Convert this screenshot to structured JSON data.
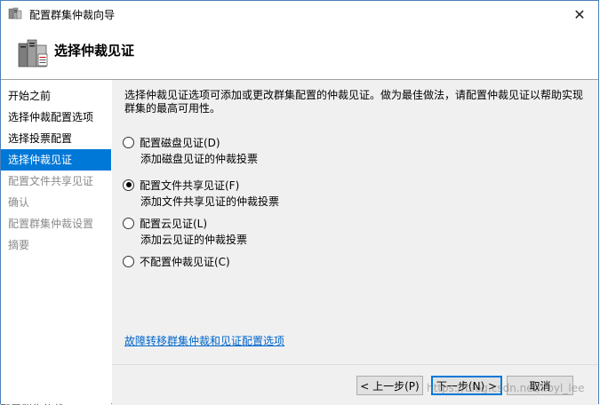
{
  "window": {
    "title": "配置群集仲裁向导",
    "close_glyph": "✕"
  },
  "header": {
    "page_title": "选择仲裁见证"
  },
  "sidebar": {
    "items": [
      {
        "label": "开始之前",
        "state": "normal"
      },
      {
        "label": "选择仲裁配置选项",
        "state": "normal"
      },
      {
        "label": "选择投票配置",
        "state": "normal"
      },
      {
        "label": "选择仲裁见证",
        "state": "selected"
      },
      {
        "label": "配置文件共享见证",
        "state": "disabled"
      },
      {
        "label": "确认",
        "state": "disabled"
      },
      {
        "label": "配置群集仲裁设置",
        "state": "disabled"
      },
      {
        "label": "摘要",
        "state": "disabled"
      }
    ]
  },
  "main": {
    "description": "选择仲裁见证选项可添加或更改群集配置的仲裁见证。做为最佳做法，请配置仲裁见证以帮助实现群集的最高可用性。",
    "options": [
      {
        "label": "配置磁盘见证(D)",
        "sub": "添加磁盘见证的仲裁投票",
        "checked": false
      },
      {
        "label": "配置文件共享见证(F)",
        "sub": "添加文件共享见证的仲裁投票",
        "checked": true
      },
      {
        "label": "配置云见证(L)",
        "sub": "添加云见证的仲裁投票",
        "checked": false
      },
      {
        "label": "不配置仲裁见证(C)",
        "sub": "",
        "checked": false
      }
    ],
    "help_link": "故障转移群集仲裁和见证配置选项"
  },
  "footer": {
    "back_label": "< 上一步(P)",
    "next_label": "下一步(N) >",
    "cancel_label": "取消"
  },
  "overlay": {
    "watermark": "https://blog.csdn.net/kbyl_lee",
    "bottom_fragment": "配置群集仲裁"
  },
  "colors": {
    "accent": "#0078d7",
    "link": "#0066cc",
    "panel_bg": "#f0f0f0"
  }
}
